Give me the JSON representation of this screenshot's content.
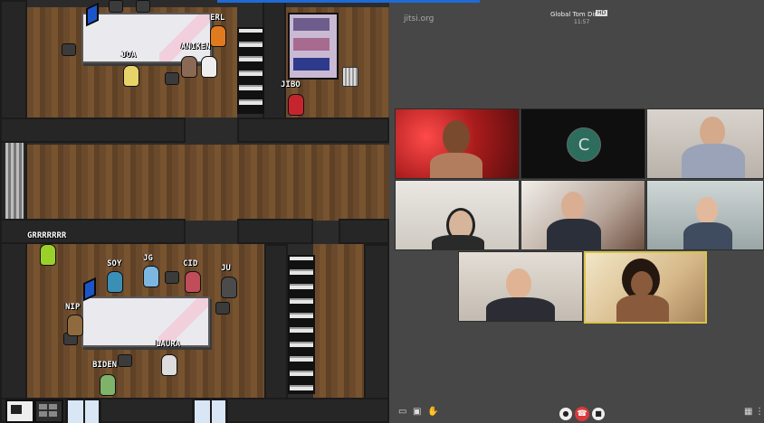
{
  "blue_bar_color": "#1f6bd6",
  "game": {
    "players": [
      {
        "name": "ERL"
      },
      {
        "name": "JOA"
      },
      {
        "name": "ANIKEN"
      },
      {
        "name": "JIBO"
      },
      {
        "name": "GRRRRRRR"
      },
      {
        "name": "SOY"
      },
      {
        "name": "JG"
      },
      {
        "name": "CID"
      },
      {
        "name": "JU"
      },
      {
        "name": "NIP"
      },
      {
        "name": "LAURA"
      },
      {
        "name": "BIDEN"
      }
    ]
  },
  "meeting": {
    "logo_text": "jitsi.org",
    "title": "Global Tom Dire",
    "title_badge": "HD",
    "timer": "11:57",
    "avatar_initial": "C",
    "tiles": [
      {
        "desc": "red lights"
      },
      {
        "desc": "avatar"
      },
      {
        "desc": "grey hair"
      },
      {
        "desc": "headphones"
      },
      {
        "desc": "attic"
      },
      {
        "desc": "woman smiling"
      },
      {
        "desc": "man smiling"
      },
      {
        "desc": "curly hair"
      }
    ],
    "toolbar_icons": [
      "chat-icon",
      "screen-share-icon",
      "raise-hand-icon",
      "microphone-icon",
      "hangup-icon",
      "camera-icon",
      "tile-view-icon",
      "more-icon"
    ]
  }
}
